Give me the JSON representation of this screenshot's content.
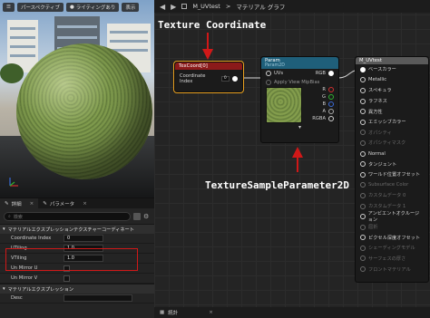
{
  "viewport": {
    "perspective_label": "パースペクティブ",
    "lighting_label": "ライティングあり",
    "show_label": "表示"
  },
  "details": {
    "tabs": [
      {
        "label": "詳細"
      },
      {
        "label": "パラメータ"
      }
    ],
    "search_placeholder": "検索",
    "section1_title": "マテリアルエクスプレッションテクスチャーコーディネート",
    "props": [
      {
        "label": "Coordinate Index",
        "value": "0"
      },
      {
        "label": "UTiling",
        "value": "1.0"
      },
      {
        "label": "VTiling",
        "value": "1.0"
      },
      {
        "label": "Un Mirror U",
        "value": ""
      },
      {
        "label": "Un Mirror V",
        "value": ""
      }
    ],
    "section2_title": "マテリアルエクスプレッション",
    "desc_label": "Desc"
  },
  "graph": {
    "breadcrumb_root": "M_UVtest",
    "breadcrumb_sep": ">",
    "breadcrumb_leaf": "マテリアル グラフ",
    "bottom_tab": "統計",
    "annotation_top": "Texture Coordinate",
    "annotation_bottom": "TextureSampleParameter2D",
    "texcoord_node": {
      "title": "TexCoord[0]",
      "pin_label": "Coordinate Index",
      "pin_value": "0"
    },
    "param_node": {
      "title": "Param",
      "subtitle": "Param2D",
      "uvs_label": "UVs",
      "uvs_hint": "Spec (Coord 0)",
      "mip_label": "Apply View MipBias",
      "outputs": [
        "RGB",
        "R",
        "G",
        "B",
        "A",
        "RGBA"
      ]
    },
    "result_node": {
      "title": "M_UVtest",
      "pins": [
        {
          "label": "ベースカラー",
          "active": true
        },
        {
          "label": "Metallic",
          "active": true
        },
        {
          "label": "スペキュラ",
          "active": true
        },
        {
          "label": "ラフネス",
          "active": true
        },
        {
          "label": "異方性",
          "active": true
        },
        {
          "label": "エミッシブカラー",
          "active": true
        },
        {
          "label": "オパシティ",
          "active": false
        },
        {
          "label": "オパシティマスク",
          "active": false
        },
        {
          "label": "Normal",
          "active": true
        },
        {
          "label": "タンジェント",
          "active": true
        },
        {
          "label": "ワールド位置オフセット",
          "active": true
        },
        {
          "label": "Subsurface Color",
          "active": false
        },
        {
          "label": "カスタムデータ 0",
          "active": false
        },
        {
          "label": "カスタムデータ 1",
          "active": false
        },
        {
          "label": "アンビエントオクルージョン",
          "active": true
        },
        {
          "label": "屈折",
          "active": false
        },
        {
          "label": "ピクセル深度オフセット",
          "active": true
        },
        {
          "label": "シェーディングモデル",
          "active": false
        },
        {
          "label": "サーフェスの厚さ",
          "active": false
        },
        {
          "label": "フロントマテリアル",
          "active": false
        }
      ]
    }
  },
  "colors": {
    "texcoord_header": "#8b1a1a",
    "param_header": "#1f5f7a",
    "result_header": "#5a5a5a",
    "annotation_arrow": "#d01818",
    "highlight_box": "#d01818"
  }
}
